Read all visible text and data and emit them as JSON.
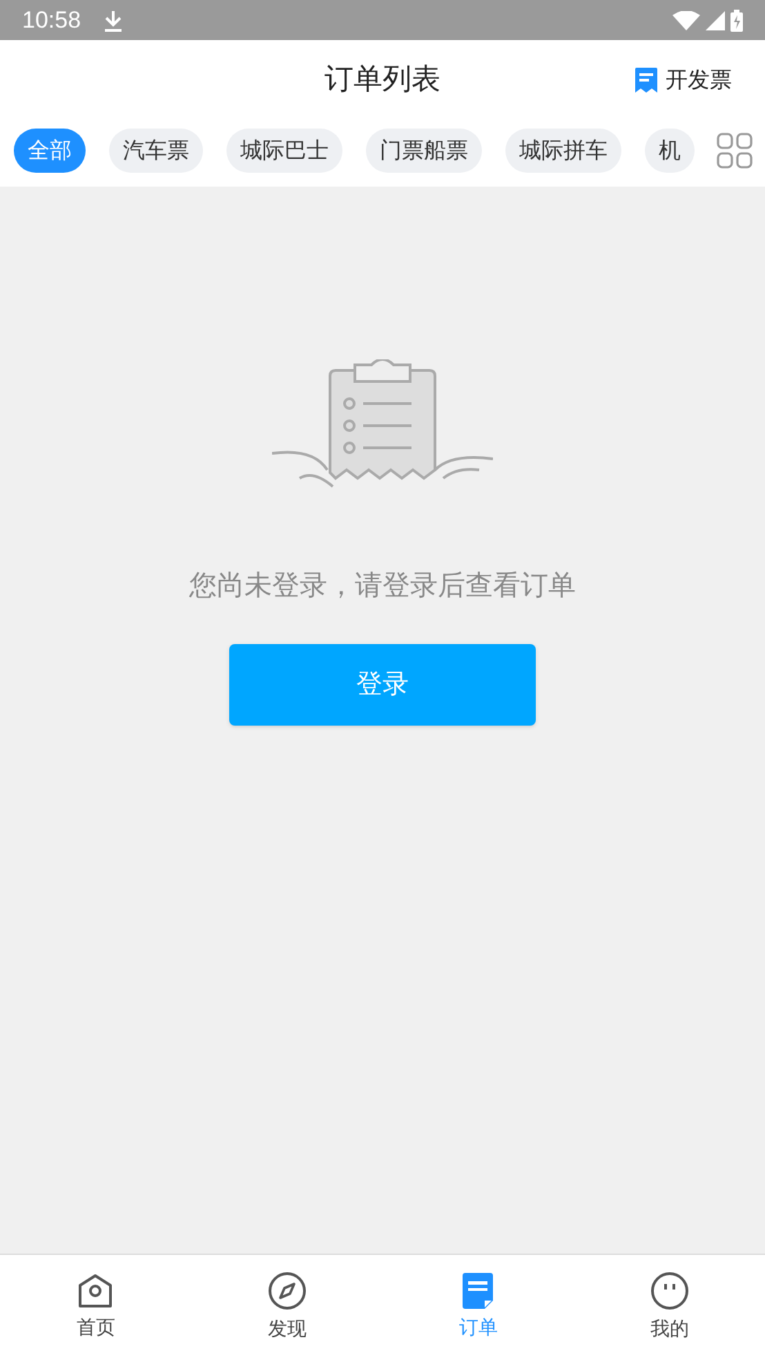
{
  "status_bar": {
    "time": "10:58"
  },
  "header": {
    "title": "订单列表",
    "action": "开发票"
  },
  "tabs": [
    {
      "label": "全部",
      "selected": true
    },
    {
      "label": "汽车票",
      "selected": false
    },
    {
      "label": "城际巴士",
      "selected": false
    },
    {
      "label": "门票船票",
      "selected": false
    },
    {
      "label": "城际拼车",
      "selected": false
    },
    {
      "label": "机",
      "selected": false
    }
  ],
  "empty_state": {
    "message": "您尚未登录，请登录后查看订单",
    "button": "登录"
  },
  "bottom_nav": [
    {
      "label": "首页",
      "kind": "home",
      "selected": false
    },
    {
      "label": "发现",
      "kind": "discover",
      "selected": false
    },
    {
      "label": "订单",
      "kind": "orders",
      "selected": true
    },
    {
      "label": "我的",
      "kind": "me",
      "selected": false
    }
  ]
}
